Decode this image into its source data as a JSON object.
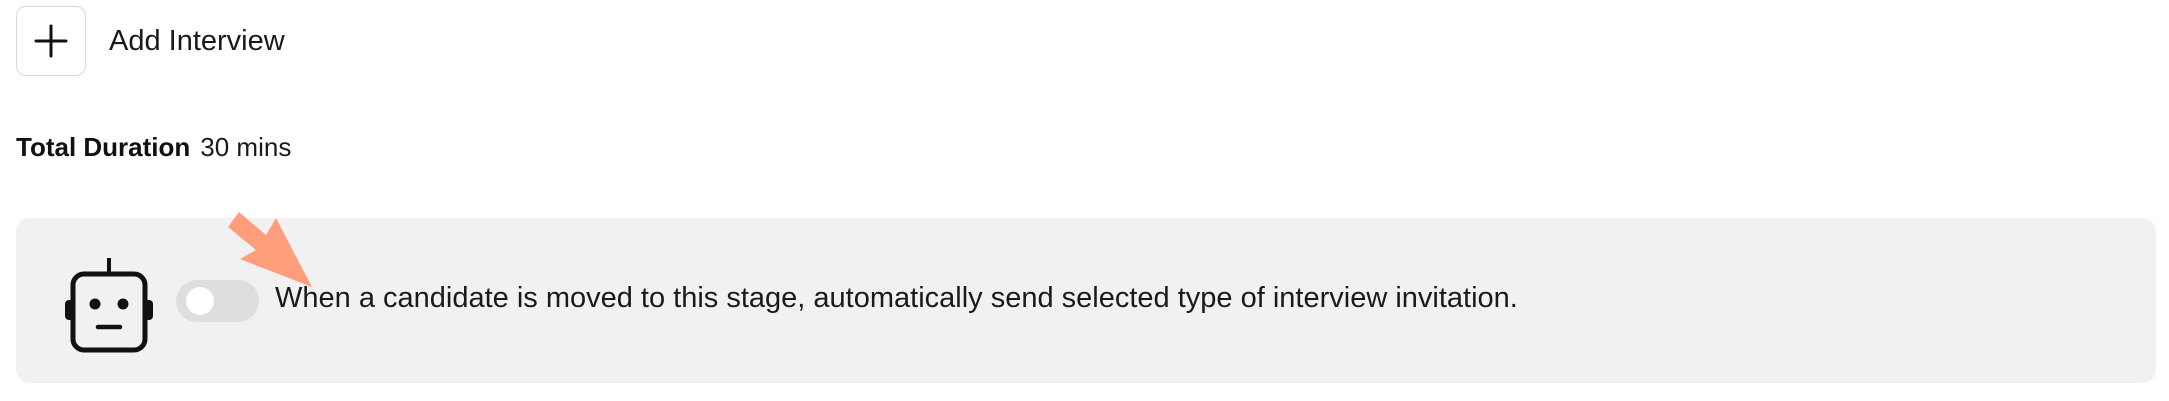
{
  "add_interview": {
    "button_icon": "plus-icon",
    "label": "Add Interview"
  },
  "duration": {
    "label": "Total Duration",
    "value": "30 mins"
  },
  "automation": {
    "icon": "robot-icon",
    "toggle_state": "off",
    "description": "When a candidate is moved to this stage, automatically send selected type of interview invitation."
  },
  "annotation": {
    "icon": "pointer-arrow-icon",
    "color": "#ff9e7d"
  },
  "colors": {
    "panel_background": "#f1f1f1",
    "toggle_track": "#dedede",
    "toggle_knob": "#ffffff",
    "text": "#1a1a1a"
  }
}
